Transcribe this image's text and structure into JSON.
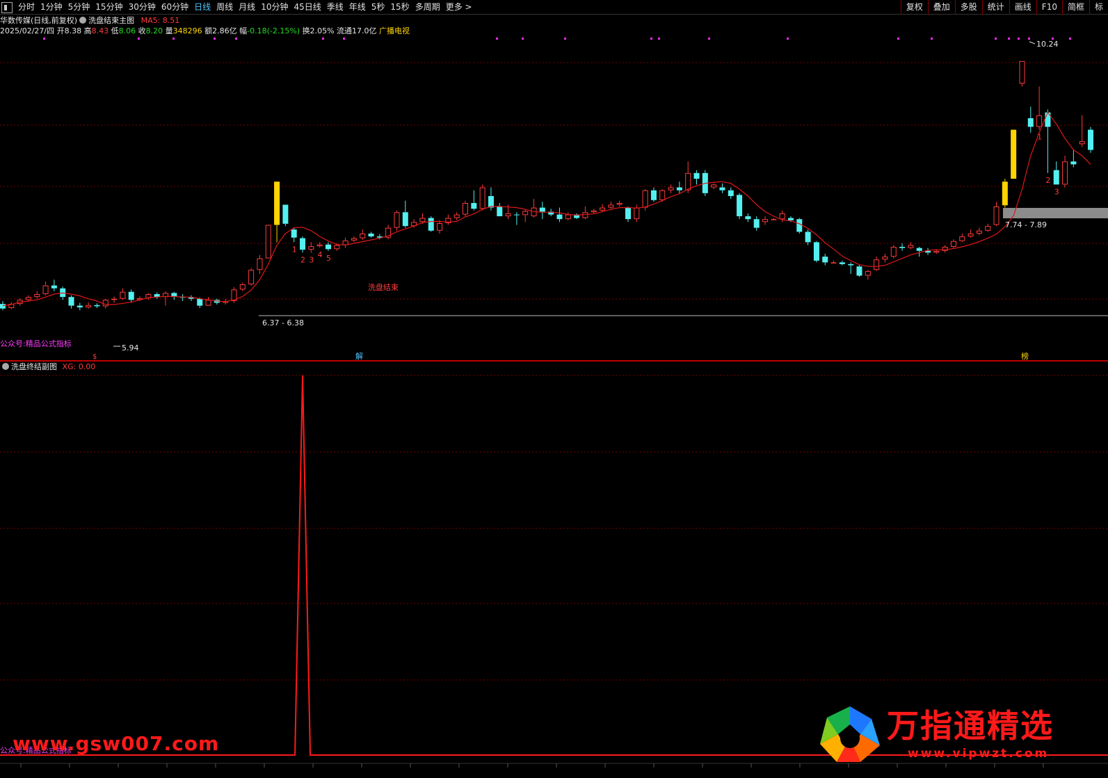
{
  "toolbar": {
    "periods": [
      "分时",
      "1分钟",
      "5分钟",
      "15分钟",
      "30分钟",
      "60分钟",
      "日线",
      "周线",
      "月线",
      "10分钟",
      "45日线",
      "季线",
      "年线",
      "5秒",
      "15秒",
      "多周期",
      "更多 >"
    ],
    "active_period": "日线",
    "right_tools": [
      "复权",
      "叠加",
      "多股",
      "统计",
      "画线",
      "F10",
      "简框",
      "标"
    ]
  },
  "stock": {
    "name": "华数传媒(日线,前复权)",
    "indicator_name": "洗盘结束主图",
    "ma_label": "MA5: 8.51",
    "date": "2025/02/27/四",
    "open_label": "开",
    "open": "8.38",
    "high_label": "高",
    "high": "8.43",
    "low_label": "低",
    "low": "8.06",
    "close_label": "收",
    "close": "8.20",
    "volume_label": "量",
    "volume": "348296",
    "amount_label": "额",
    "amount": "2.86亿",
    "change_label": "幅",
    "change": "-0.18(-2.15%)",
    "turnover_label": "换",
    "turnover": "2.05%",
    "float_label": "流通",
    "float": "17.0亿",
    "sector": "广播电视"
  },
  "sub_panel": {
    "indicator_name": "洗盘终结副图",
    "xg_label": "XG: 0.00"
  },
  "annotations": {
    "peak": "10.24",
    "low_mark": "5.94",
    "range_low": "6.37 - 6.38",
    "range_high": "7.74 - 7.89",
    "signal": "洗盘结束",
    "event_s": "$",
    "event_jie": "解",
    "event_bang": "榜",
    "watermark_main": "公众号:精品公式指标",
    "watermark_sub": "公众号:精品公式指标"
  },
  "watermark": {
    "url": "www.gsw007.com",
    "logo_title": "万指通精选",
    "logo_url": "www.vipwzt.com"
  },
  "colors": {
    "up": "#ff3c3c",
    "down": "#54f0f0",
    "signal": "#ffd400",
    "ma": "#e01818",
    "grid": "#7a0000",
    "panel_border": "#c00000"
  },
  "chart_data": {
    "type": "candlestick",
    "price_range": [
      5.2,
      10.6
    ],
    "candles": [
      [
        6.03,
        5.95,
        6.08,
        5.92
      ],
      [
        5.96,
        6.03,
        6.06,
        5.94
      ],
      [
        6.03,
        6.1,
        6.13,
        6.0
      ],
      [
        6.1,
        6.15,
        6.18,
        6.07
      ],
      [
        6.15,
        6.2,
        6.25,
        6.12
      ],
      [
        6.2,
        6.35,
        6.42,
        6.18
      ],
      [
        6.35,
        6.3,
        6.45,
        6.25
      ],
      [
        6.3,
        6.15,
        6.33,
        6.1
      ],
      [
        6.15,
        6.0,
        6.18,
        5.95
      ],
      [
        6.0,
        5.97,
        6.05,
        5.92
      ],
      [
        5.97,
        6.01,
        6.06,
        5.95
      ],
      [
        6.01,
        5.99,
        6.04,
        5.96
      ],
      [
        5.99,
        6.1,
        6.12,
        5.95
      ],
      [
        6.1,
        6.12,
        6.16,
        6.05
      ],
      [
        6.12,
        6.24,
        6.3,
        6.1
      ],
      [
        6.24,
        6.1,
        6.28,
        6.05
      ],
      [
        6.1,
        6.13,
        6.16,
        6.08
      ],
      [
        6.13,
        6.2,
        6.22,
        6.1
      ],
      [
        6.2,
        6.15,
        6.23,
        6.12
      ],
      [
        6.15,
        6.22,
        6.25,
        6.0
      ],
      [
        6.22,
        6.15,
        6.24,
        6.1
      ],
      [
        6.15,
        6.14,
        6.2,
        6.08
      ],
      [
        6.14,
        6.12,
        6.18,
        6.08
      ],
      [
        6.12,
        6.0,
        6.14,
        5.96
      ],
      [
        6.0,
        6.1,
        6.15,
        6.05
      ],
      [
        6.1,
        6.05,
        6.12,
        6.02
      ],
      [
        6.05,
        6.08,
        6.12,
        6.02
      ],
      [
        6.08,
        6.28,
        6.32,
        6.05
      ],
      [
        6.28,
        6.37,
        6.4,
        6.25
      ],
      [
        6.37,
        6.62,
        6.65,
        6.35
      ],
      [
        6.62,
        6.82,
        6.88,
        6.55
      ],
      [
        6.82,
        7.4,
        7.4,
        6.82
      ],
      [
        7.4,
        8.15,
        8.15,
        7.1
      ],
      [
        7.75,
        7.42,
        7.75,
        7.38
      ],
      [
        7.32,
        7.18,
        7.35,
        7.1
      ],
      [
        7.17,
        6.97,
        7.2,
        6.92
      ],
      [
        6.97,
        7.03,
        7.1,
        6.92
      ],
      [
        7.03,
        7.06,
        7.1,
        7.01
      ],
      [
        7.06,
        6.98,
        7.1,
        6.95
      ],
      [
        6.98,
        7.05,
        7.08,
        6.95
      ],
      [
        7.05,
        7.13,
        7.18,
        7.0
      ],
      [
        7.13,
        7.17,
        7.2,
        7.1
      ],
      [
        7.17,
        7.25,
        7.32,
        7.14
      ],
      [
        7.25,
        7.2,
        7.28,
        7.18
      ],
      [
        7.2,
        7.18,
        7.24,
        7.15
      ],
      [
        7.18,
        7.35,
        7.4,
        7.15
      ],
      [
        7.35,
        7.62,
        7.65,
        7.3
      ],
      [
        7.62,
        7.38,
        7.82,
        7.35
      ],
      [
        7.38,
        7.45,
        7.5,
        7.35
      ],
      [
        7.45,
        7.52,
        7.6,
        7.42
      ],
      [
        7.52,
        7.3,
        7.55,
        7.28
      ],
      [
        7.3,
        7.43,
        7.48,
        7.25
      ],
      [
        7.43,
        7.52,
        7.58,
        7.4
      ],
      [
        7.52,
        7.58,
        7.62,
        7.48
      ],
      [
        7.58,
        7.78,
        7.82,
        7.55
      ],
      [
        7.78,
        7.68,
        8.0,
        7.65
      ],
      [
        7.68,
        8.05,
        8.1,
        7.65
      ],
      [
        7.9,
        7.7,
        8.05,
        7.65
      ],
      [
        7.72,
        7.55,
        7.78,
        7.55
      ],
      [
        7.55,
        7.6,
        7.75,
        7.5
      ],
      [
        7.58,
        7.57,
        7.62,
        7.4
      ],
      [
        7.57,
        7.64,
        7.66,
        7.45
      ],
      [
        7.55,
        7.7,
        7.85,
        7.53
      ],
      [
        7.7,
        7.63,
        7.8,
        7.5
      ],
      [
        7.63,
        7.58,
        7.68,
        7.55
      ],
      [
        7.58,
        7.5,
        7.7,
        7.45
      ],
      [
        7.5,
        7.58,
        7.62,
        7.48
      ],
      [
        7.58,
        7.52,
        7.6,
        7.5
      ],
      [
        7.52,
        7.62,
        7.72,
        7.5
      ],
      [
        7.62,
        7.65,
        7.68,
        7.6
      ],
      [
        7.65,
        7.7,
        7.76,
        7.62
      ],
      [
        7.7,
        7.75,
        7.8,
        7.68
      ],
      [
        7.75,
        7.78,
        7.82,
        7.72
      ],
      [
        7.7,
        7.5,
        7.72,
        7.45
      ],
      [
        7.5,
        7.7,
        7.75,
        7.45
      ],
      [
        7.7,
        8.0,
        8.02,
        7.65
      ],
      [
        8.0,
        7.83,
        8.05,
        7.8
      ],
      [
        7.83,
        8.0,
        8.02,
        7.8
      ],
      [
        8.0,
        8.05,
        8.1,
        7.95
      ],
      [
        8.05,
        8.0,
        8.15,
        7.95
      ],
      [
        8.0,
        8.3,
        8.5,
        7.95
      ],
      [
        8.3,
        8.2,
        8.35,
        8.1
      ],
      [
        8.3,
        7.95,
        8.35,
        7.9
      ],
      [
        8.05,
        8.1,
        8.12,
        8.02
      ],
      [
        8.05,
        8.0,
        8.12,
        7.95
      ],
      [
        8.0,
        7.9,
        8.05,
        7.85
      ],
      [
        7.92,
        7.55,
        7.95,
        7.5
      ],
      [
        7.55,
        7.5,
        7.6,
        7.45
      ],
      [
        7.5,
        7.35,
        7.55,
        7.3
      ],
      [
        7.45,
        7.5,
        7.55,
        7.4
      ],
      [
        7.5,
        7.5,
        7.52,
        7.48
      ],
      [
        7.5,
        7.6,
        7.65,
        7.45
      ],
      [
        7.52,
        7.48,
        7.55,
        7.45
      ],
      [
        7.5,
        7.28,
        7.52,
        7.25
      ],
      [
        7.28,
        7.1,
        7.32,
        7.05
      ],
      [
        7.1,
        6.78,
        7.12,
        6.75
      ],
      [
        6.85,
        6.75,
        6.9,
        6.7
      ],
      [
        6.75,
        6.75,
        6.78,
        6.73
      ],
      [
        6.75,
        6.72,
        6.78,
        6.7
      ],
      [
        6.72,
        6.7,
        6.75,
        6.55
      ],
      [
        6.68,
        6.52,
        6.7,
        6.5
      ],
      [
        6.52,
        6.6,
        6.62,
        6.45
      ],
      [
        6.62,
        6.8,
        6.85,
        6.6
      ],
      [
        6.8,
        6.85,
        6.9,
        6.75
      ],
      [
        6.85,
        7.02,
        7.05,
        6.82
      ],
      [
        7.02,
        7.0,
        7.08,
        6.95
      ],
      [
        7.0,
        7.05,
        7.1,
        6.98
      ],
      [
        7.0,
        6.95,
        7.02,
        6.85
      ],
      [
        6.95,
        6.92,
        7.0,
        6.88
      ],
      [
        6.92,
        6.95,
        6.98,
        6.9
      ],
      [
        6.95,
        7.02,
        7.05,
        6.92
      ],
      [
        7.02,
        7.12,
        7.15,
        7.0
      ],
      [
        7.12,
        7.2,
        7.25,
        7.1
      ],
      [
        7.2,
        7.25,
        7.32,
        7.18
      ],
      [
        7.25,
        7.3,
        7.35,
        7.22
      ],
      [
        7.3,
        7.38,
        7.42,
        7.28
      ],
      [
        7.4,
        7.72,
        7.8,
        7.38
      ],
      [
        7.74,
        8.15,
        8.2,
        7.7
      ],
      [
        8.2,
        9.05,
        9.05,
        8.2
      ],
      [
        9.85,
        10.24,
        10.24,
        9.8
      ],
      [
        9.25,
        9.1,
        9.45,
        9.0
      ],
      [
        9.1,
        9.3,
        9.8,
        9.05
      ],
      [
        9.35,
        9.1,
        9.4,
        8.3
      ],
      [
        8.35,
        8.1,
        8.5,
        8.1
      ],
      [
        8.1,
        8.5,
        8.6,
        8.05
      ],
      [
        8.5,
        8.45,
        8.7,
        8.4
      ],
      [
        8.8,
        8.85,
        9.3,
        8.75
      ],
      [
        9.05,
        8.7,
        9.1,
        8.65
      ]
    ],
    "ma5": [
      6.0,
      6.02,
      6.06,
      6.08,
      6.1,
      6.15,
      6.2,
      6.22,
      6.2,
      6.17,
      6.12,
      6.08,
      6.02,
      6.02,
      6.04,
      6.06,
      6.1,
      6.14,
      6.15,
      6.16,
      6.16,
      6.15,
      6.15,
      6.12,
      6.1,
      6.08,
      6.07,
      6.1,
      6.16,
      6.27,
      6.45,
      6.72,
      7.05,
      7.25,
      7.35,
      7.36,
      7.3,
      7.2,
      7.12,
      7.06,
      7.05,
      7.08,
      7.11,
      7.14,
      7.17,
      7.21,
      7.28,
      7.33,
      7.38,
      7.44,
      7.46,
      7.46,
      7.45,
      7.46,
      7.54,
      7.59,
      7.67,
      7.72,
      7.72,
      7.71,
      7.7,
      7.67,
      7.63,
      7.62,
      7.62,
      7.61,
      7.58,
      7.57,
      7.58,
      7.59,
      7.63,
      7.67,
      7.7,
      7.7,
      7.69,
      7.71,
      7.76,
      7.82,
      7.89,
      7.94,
      8.02,
      8.08,
      8.12,
      8.14,
      8.15,
      8.12,
      8.02,
      7.9,
      7.75,
      7.63,
      7.55,
      7.49,
      7.47,
      7.42,
      7.34,
      7.23,
      7.09,
      6.98,
      6.86,
      6.78,
      6.71,
      6.68,
      6.68,
      6.7,
      6.76,
      6.82,
      6.88,
      6.92,
      6.96,
      6.97,
      6.97,
      6.99,
      7.02,
      7.06,
      7.11,
      7.17,
      7.24,
      7.37,
      7.56,
      8.02,
      8.6,
      9.0,
      9.35,
      9.15,
      8.9,
      8.7,
      8.6,
      8.45
    ],
    "sub_series": {
      "name": "XG",
      "spike_index": 35,
      "spike_value": 1,
      "baseline": 0
    }
  }
}
